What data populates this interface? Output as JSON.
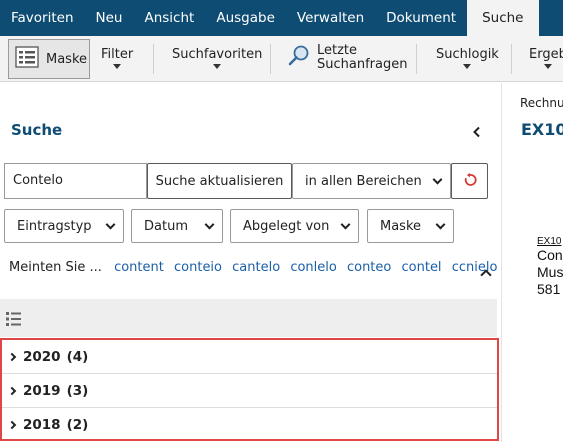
{
  "menubar": {
    "items": [
      "Favoriten",
      "Neu",
      "Ansicht",
      "Ausgabe",
      "Verwalten",
      "Dokument",
      "Suche"
    ],
    "active": "Suche",
    "color": "#0f4c74"
  },
  "ribbon": {
    "maske": "Maske",
    "filter": "Filter",
    "suchfavoriten": "Suchfavoriten",
    "letzte_line1": "Letzte",
    "letzte_line2": "Suchanfragen",
    "suchlogik": "Suchlogik",
    "ergebnis": "Ergeb"
  },
  "search": {
    "title": "Suche",
    "query": "Contelo",
    "update_button": "Suche aktualisieren",
    "scope": "in allen Bereichen",
    "filters": {
      "eintragstyp": "Eintragstyp",
      "datum": "Datum",
      "abgelegt_von": "Abgelegt von",
      "maske": "Maske"
    },
    "suggest_label": "Meinten Sie ...",
    "suggestions": [
      "content",
      "conteio",
      "cantelo",
      "conlelo",
      "conteo",
      "contel",
      "ccnielo"
    ]
  },
  "groups": [
    {
      "year": "2020",
      "count": "(4)"
    },
    {
      "year": "2019",
      "count": "(3)"
    },
    {
      "year": "2018",
      "count": "(2)"
    }
  ],
  "preview": {
    "label": "Rechnu",
    "title": "EX10",
    "doc_ref": "EX10",
    "doc_line1": "Con",
    "doc_line2": "Mus",
    "doc_line3": "581"
  },
  "colors": {
    "accent": "#0f4c74",
    "link": "#1b5fa8",
    "highlight": "#e04646"
  }
}
